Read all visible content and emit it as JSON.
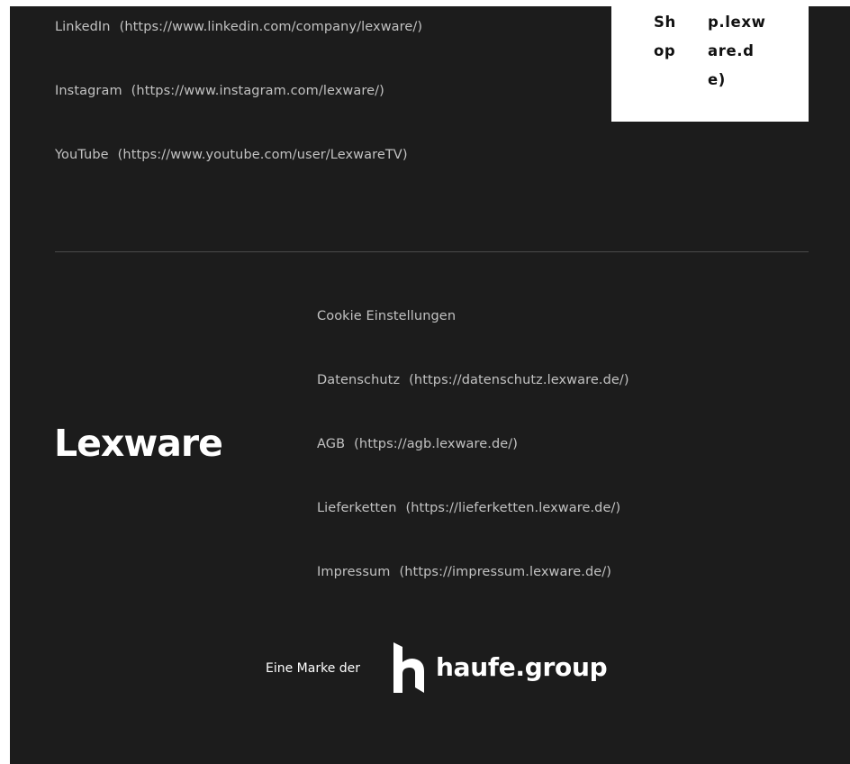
{
  "social": [
    {
      "label": "LinkedIn",
      "url": "(https://www.linkedin.com/company/lexware/)"
    },
    {
      "label": "Instagram",
      "url": "(https://www.instagram.com/lexware/)"
    },
    {
      "label": "YouTube",
      "url": "(https://www.youtube.com/user/LexwareTV)"
    }
  ],
  "shop_card": {
    "col1": [
      "Sh",
      "op"
    ],
    "col2": [
      "p.lexw",
      "are.d",
      "e)"
    ]
  },
  "logo": {
    "text": "Lexware"
  },
  "legal": [
    {
      "label": "Cookie Einstellungen",
      "url": ""
    },
    {
      "label": "Datenschutz",
      "url": "(https://datenschutz.lexware.de/)"
    },
    {
      "label": "AGB",
      "url": "(https://agb.lexware.de/)"
    },
    {
      "label": "Lieferketten",
      "url": "(https://lieferketten.lexware.de/)"
    },
    {
      "label": "Impressum",
      "url": "(https://impressum.lexware.de/)"
    }
  ],
  "brand": {
    "tagline": "Eine Marke der",
    "name": "haufe.group"
  },
  "colors": {
    "background": "#1c1c1c",
    "text_muted": "#c2c2c2",
    "divider": "#4a4a4a",
    "card": "#ffffff"
  },
  "icons": [
    "haufe-h-icon"
  ]
}
